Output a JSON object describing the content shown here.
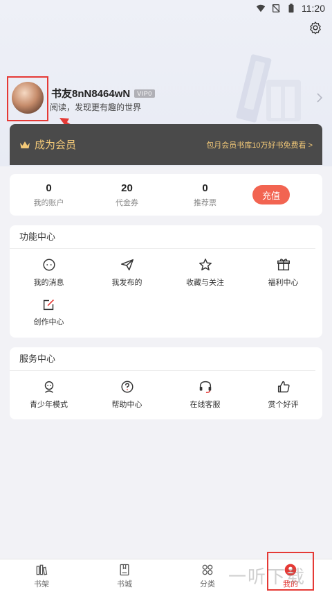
{
  "status_bar": {
    "time": "11:20"
  },
  "profile": {
    "username": "书友8nN8464wN",
    "vip_badge": "VIP0",
    "slogan": "阅读，发现更有趣的世界"
  },
  "member": {
    "label": "成为会员",
    "promo": "包月会员书库10万好书免费看 >"
  },
  "stats": [
    {
      "value": "0",
      "label": "我的账户"
    },
    {
      "value": "20",
      "label": "代金券"
    },
    {
      "value": "0",
      "label": "推荐票"
    }
  ],
  "recharge_label": "充值",
  "func_center": {
    "title": "功能中心",
    "items": [
      {
        "label": "我的消息",
        "icon": "message-icon"
      },
      {
        "label": "我发布的",
        "icon": "paper-plane-icon"
      },
      {
        "label": "收藏与关注",
        "icon": "star-icon"
      },
      {
        "label": "福利中心",
        "icon": "gift-icon"
      },
      {
        "label": "创作中心",
        "icon": "edit-icon"
      }
    ]
  },
  "service_center": {
    "title": "服务中心",
    "items": [
      {
        "label": "青少年模式",
        "icon": "teen-mode-icon"
      },
      {
        "label": "帮助中心",
        "icon": "help-icon"
      },
      {
        "label": "在线客服",
        "icon": "headset-icon"
      },
      {
        "label": "赏个好评",
        "icon": "thumbs-up-icon"
      }
    ]
  },
  "tabs": [
    {
      "label": "书架",
      "icon": "bookshelf-icon"
    },
    {
      "label": "书城",
      "icon": "bookstore-icon"
    },
    {
      "label": "分类",
      "icon": "category-icon"
    },
    {
      "label": "我的",
      "icon": "profile-icon"
    }
  ],
  "watermark": "一听下载",
  "colors": {
    "accent": "#e53935",
    "recharge": "#f26451",
    "gold": "#f3c978",
    "member_bg": "#4a4a4a"
  }
}
